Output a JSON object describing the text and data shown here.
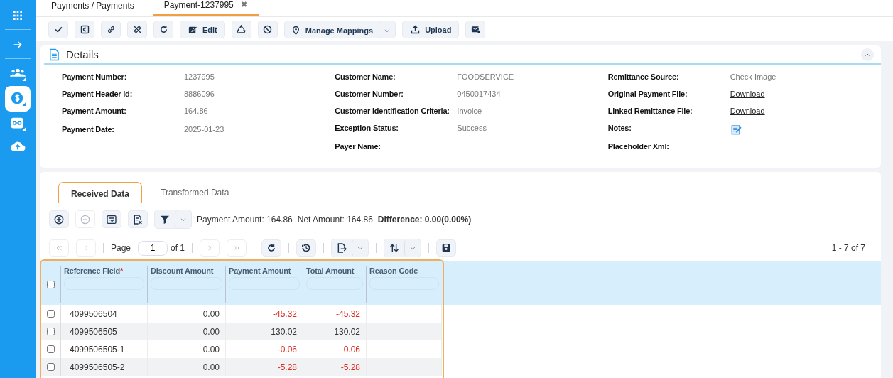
{
  "sidebar": {
    "items": [
      {
        "selected": false
      },
      {
        "selected": false
      },
      {
        "selected": false
      },
      {
        "selected": true
      },
      {
        "selected": false
      },
      {
        "selected": false
      }
    ]
  },
  "tabs": [
    {
      "label": "Payments / Payments",
      "selected": false
    },
    {
      "label": "Payment-1237995",
      "selected": true,
      "close": "✖"
    }
  ],
  "toolbar": [
    {
      "kind": "icon"
    },
    {
      "kind": "icon"
    },
    {
      "kind": "icon"
    },
    {
      "kind": "icon"
    },
    {
      "kind": "icon"
    },
    {
      "kind": "text",
      "label": "Edit"
    },
    {
      "kind": "icon"
    },
    {
      "kind": "icon"
    },
    {
      "kind": "split",
      "label": "Manage Mappings"
    },
    {
      "kind": "text",
      "label": "Upload"
    },
    {
      "kind": "icon"
    }
  ],
  "details": {
    "title": "Details",
    "expanded": true,
    "columns": [
      [
        {
          "label": "Payment Number:",
          "kind": "text",
          "value": "1237995"
        },
        {
          "label": "Payment Header Id:",
          "kind": "text",
          "value": "8886096"
        },
        {
          "label": "Payment Amount:",
          "kind": "text",
          "value": "164.86"
        },
        {
          "label": "Payment Date:",
          "kind": "text",
          "value": "2025-01-23"
        }
      ],
      [
        {
          "label": "Customer Name:",
          "kind": "text",
          "value": "FOODSERVICE"
        },
        {
          "label": "Customer Number:",
          "kind": "text",
          "value": "0450017434"
        },
        {
          "label": "Customer Identification Criteria:",
          "kind": "text",
          "value": "Invoice"
        },
        {
          "label": "Exception Status:",
          "kind": "text",
          "value": "Success"
        },
        {
          "label": "Payer Name:",
          "kind": "empty"
        }
      ],
      [
        {
          "label": "Remittance Source:",
          "kind": "text",
          "value": "Check Image"
        },
        {
          "label": "Original Payment File:",
          "kind": "link",
          "value": "Download"
        },
        {
          "label": "Linked Remittance File:",
          "kind": "link",
          "value": "Download"
        },
        {
          "label": "Notes:",
          "kind": "icon"
        },
        {
          "label": "Placeholder Xml:",
          "kind": "empty"
        }
      ]
    ]
  },
  "data_tabs": [
    {
      "label": "Received Data",
      "selected": true
    },
    {
      "label": "Transformed Data",
      "selected": false
    }
  ],
  "grid_toolbar": [
    {
      "kind": "icon",
      "disabled": false
    },
    {
      "kind": "icon",
      "disabled": true
    },
    {
      "kind": "icon",
      "disabled": false
    },
    {
      "kind": "icon",
      "disabled": false
    },
    {
      "kind": "split",
      "disabled": false
    }
  ],
  "summary": {
    "payment_amount": "Payment Amount: 164.86",
    "net_amount": "Net Amount: 164.86",
    "difference": "Difference: 0.00(0.00%)"
  },
  "pager": {
    "nav_before": [
      {
        "disabled": true
      },
      {
        "disabled": true
      }
    ],
    "page_label": "Page",
    "page": "1",
    "page_count": "of 1",
    "nav_after": [
      {
        "disabled": true
      },
      {
        "disabled": true
      }
    ],
    "tools": [
      {
        "kind": "icon"
      },
      {
        "kind": "icon"
      },
      {
        "kind": "split"
      },
      {
        "kind": "split"
      },
      {
        "kind": "icon"
      }
    ],
    "range": "1 - 7 of 7"
  },
  "grid": {
    "header_checked": false,
    "columns": [
      {
        "label": "Reference Field",
        "required_mark": "*"
      },
      {
        "label": "Discount Amount"
      },
      {
        "label": "Payment Amount"
      },
      {
        "label": "Total Amount"
      },
      {
        "label": "Reason Code"
      }
    ],
    "rows": [
      {
        "checked": false,
        "cells": [
          {
            "text": "4099506504",
            "negative": false
          },
          {
            "text": "0.00",
            "negative": false
          },
          {
            "text": "-45.32",
            "negative": true
          },
          {
            "text": "-45.32",
            "negative": true
          }
        ]
      },
      {
        "checked": false,
        "cells": [
          {
            "text": "4099506505",
            "negative": false
          },
          {
            "text": "0.00",
            "negative": false
          },
          {
            "text": "130.02",
            "negative": false
          },
          {
            "text": "130.02",
            "negative": false
          }
        ]
      },
      {
        "checked": false,
        "cells": [
          {
            "text": "4099506505-1",
            "negative": false
          },
          {
            "text": "0.00",
            "negative": false
          },
          {
            "text": "-0.06",
            "negative": true
          },
          {
            "text": "-0.06",
            "negative": true
          }
        ]
      },
      {
        "checked": false,
        "cells": [
          {
            "text": "4099506505-2",
            "negative": false
          },
          {
            "text": "0.00",
            "negative": false
          },
          {
            "text": "-5.28",
            "negative": true
          },
          {
            "text": "-5.28",
            "negative": true
          }
        ]
      }
    ]
  }
}
